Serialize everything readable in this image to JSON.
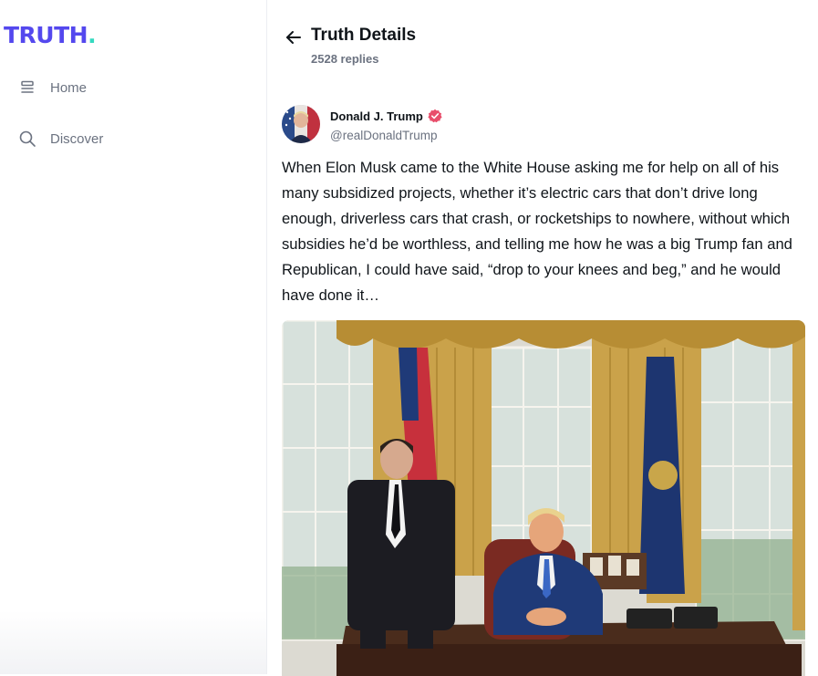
{
  "brand": {
    "logo_text": "TRUTH",
    "logo_dot": "."
  },
  "sidebar": {
    "items": [
      {
        "label": "Home",
        "icon": "home-icon"
      },
      {
        "label": "Discover",
        "icon": "search-icon"
      }
    ]
  },
  "header": {
    "title": "Truth Details",
    "replies": "2528 replies",
    "back_icon": "arrow-left-icon"
  },
  "post": {
    "author": "Donald J. Trump",
    "handle": "@realDonaldTrump",
    "verified_icon": "verified-badge-icon",
    "text": "When Elon Musk came to the White House asking me for help on all of his many subsidized projects, whether it’s electric cars that don’t drive long enough, driverless cars that crash, or rocketships to nowhere, without which subsidies he’d be worthless, and telling me how he was a big Trump fan and Republican, I could have said, “drop to your knees and beg,” and he would have done it…"
  },
  "colors": {
    "brand": "#5448ee",
    "brand_accent": "#34d9c0",
    "verified": "#e84e6b",
    "muted": "#6b7280"
  }
}
